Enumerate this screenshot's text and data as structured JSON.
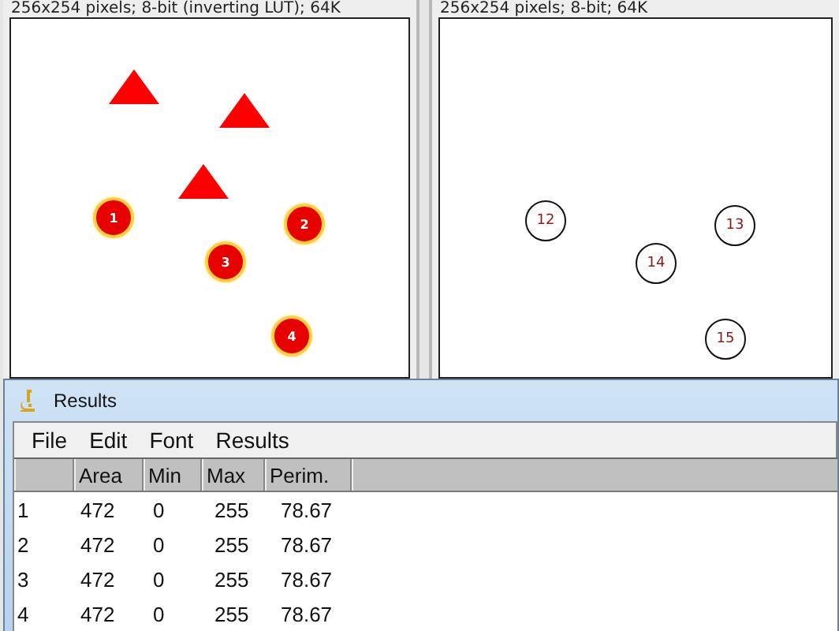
{
  "image_windows": [
    {
      "subtitle": "256x254 pixels; 8-bit (inverting LUT); 64K",
      "shapes": [
        {
          "kind": "triangle"
        },
        {
          "kind": "triangle"
        },
        {
          "kind": "triangle"
        },
        {
          "kind": "particle",
          "label": "1"
        },
        {
          "kind": "particle",
          "label": "2"
        },
        {
          "kind": "particle",
          "label": "3"
        },
        {
          "kind": "particle",
          "label": "4"
        }
      ]
    },
    {
      "subtitle": "256x254 pixels; 8-bit; 64K",
      "shapes": [
        {
          "kind": "ring",
          "label": "12"
        },
        {
          "kind": "ring",
          "label": "13"
        },
        {
          "kind": "ring",
          "label": "14"
        },
        {
          "kind": "ring",
          "label": "15"
        }
      ]
    }
  ],
  "results": {
    "title": "Results",
    "menu": [
      "File",
      "Edit",
      "Font",
      "Results"
    ],
    "columns": [
      "Area",
      "Min",
      "Max",
      "Perim."
    ],
    "rows": [
      {
        "index": "1",
        "cells": [
          "472",
          "0",
          "255",
          "78.67"
        ]
      },
      {
        "index": "2",
        "cells": [
          "472",
          "0",
          "255",
          "78.67"
        ]
      },
      {
        "index": "3",
        "cells": [
          "472",
          "0",
          "255",
          "78.67"
        ]
      },
      {
        "index": "4",
        "cells": [
          "472",
          "0",
          "255",
          "78.67"
        ]
      }
    ]
  }
}
